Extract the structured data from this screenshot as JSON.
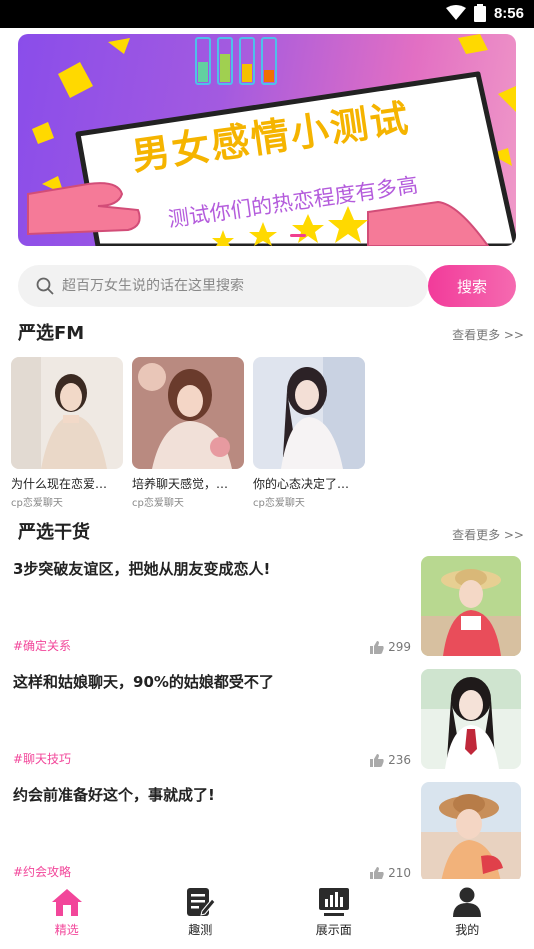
{
  "status_bar": {
    "time": "8:56"
  },
  "banner": {
    "title": "男女感情小测试",
    "subtitle": "测试你们的热恋程度有多高"
  },
  "search": {
    "placeholder": "超百万女生说的话在这里搜索",
    "button_label": "搜索"
  },
  "fm_section": {
    "title": "严选FM",
    "more_label": "查看更多 >>",
    "items": [
      {
        "title": "为什么现在恋爱…",
        "source": "cp恋爱聊天"
      },
      {
        "title": "培养聊天感觉，…",
        "source": "cp恋爱聊天"
      },
      {
        "title": "你的心态决定了…",
        "source": "cp恋爱聊天"
      }
    ]
  },
  "articles_section": {
    "title": "严选干货",
    "more_label": "查看更多 >>",
    "items": [
      {
        "title": "3步突破友谊区，把她从朋友变成恋人!",
        "tag": "#确定关系",
        "likes": "299"
      },
      {
        "title": "这样和姑娘聊天，90%的姑娘都受不了",
        "tag": "#聊天技巧",
        "likes": "236"
      },
      {
        "title": "约会前准备好这个，事就成了!",
        "tag": "#约会攻略",
        "likes": "210"
      }
    ]
  },
  "tab_bar": {
    "tabs": [
      {
        "label": "精选",
        "icon": "home-icon"
      },
      {
        "label": "趣测",
        "icon": "note-edit-icon"
      },
      {
        "label": "展示面",
        "icon": "chart-monitor-icon"
      },
      {
        "label": "我的",
        "icon": "user-icon"
      }
    ]
  },
  "colors": {
    "accent": "#f2469a",
    "banner_yellow": "#f5b400"
  }
}
